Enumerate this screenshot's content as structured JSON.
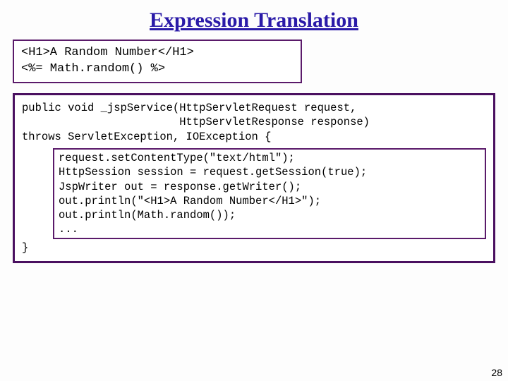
{
  "title": "Expression Translation",
  "jsp": {
    "line1": "<H1>A Random Number</H1>",
    "line2": "<%= Math.random() %>"
  },
  "servlet": {
    "sig": "public void _jspService(HttpServletRequest request,\n                        HttpServletResponse response)\nthrows ServletException, IOException {",
    "body": "request.setContentType(\"text/html\");\nHttpSession session = request.getSession(true);\nJspWriter out = response.getWriter();\nout.println(\"<H1>A Random Number</H1>\");\nout.println(Math.random());\n...",
    "close": "}"
  },
  "page_number": "28"
}
